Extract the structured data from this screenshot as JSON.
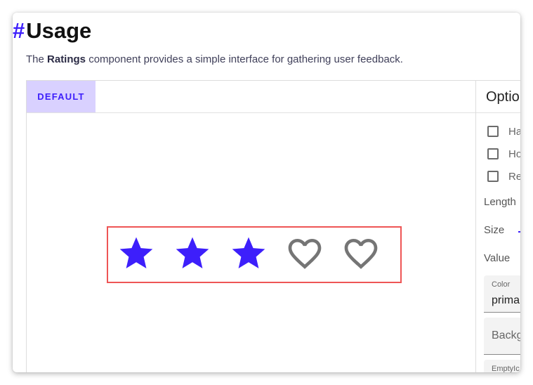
{
  "heading": {
    "hash": "#",
    "title": "Usage"
  },
  "description": {
    "prefix": "The ",
    "component": "Ratings",
    "suffix": " component provides a simple interface for gathering user feedback."
  },
  "tabs": [
    {
      "label": "DEFAULT",
      "active": true
    }
  ],
  "rating": {
    "value": 3,
    "length": 5,
    "full_icon": "star-icon",
    "empty_icon": "heart-outline-icon",
    "full_color": "#3d1ffb",
    "empty_color": "#757575"
  },
  "options": {
    "title": "Optio",
    "checkboxes": [
      {
        "label": "Ha",
        "checked": false
      },
      {
        "label": "Ho",
        "checked": false
      },
      {
        "label": "Re",
        "checked": false
      }
    ],
    "length_label": "Length",
    "size_label": "Size",
    "value_label": "Value",
    "color_field": {
      "label": "Color",
      "value": "prima"
    },
    "background_field": {
      "placeholder": "Backg"
    },
    "empty_icon_field": {
      "label": "EmptyIc"
    }
  },
  "colors": {
    "accent": "#3d1ffb",
    "tab_active_bg": "#d9d1ff",
    "highlight_border": "#ee5555"
  }
}
